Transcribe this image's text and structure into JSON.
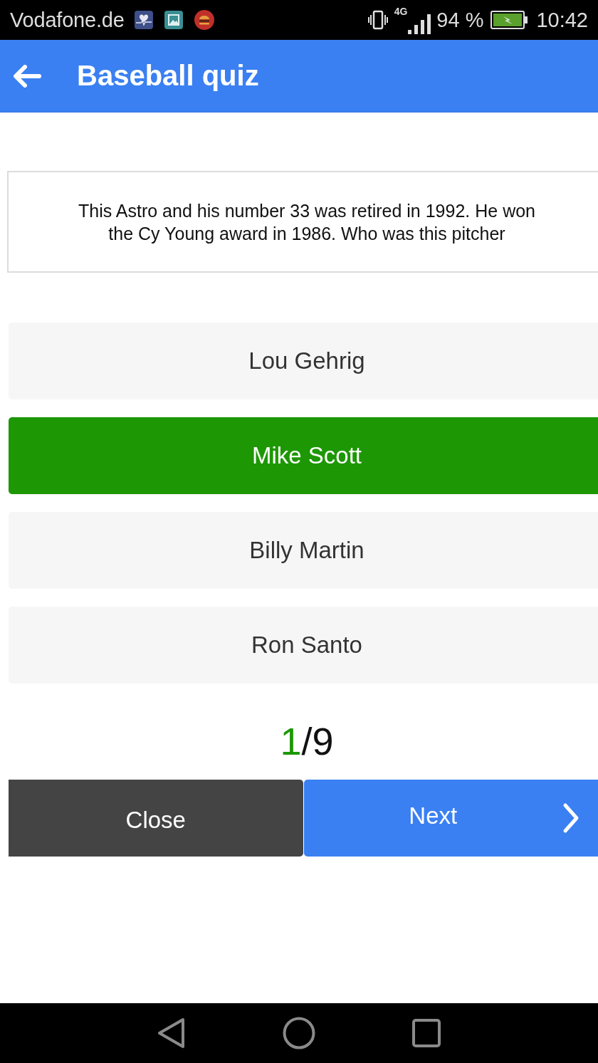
{
  "status_bar": {
    "carrier": "Vodafone.de",
    "network": "4G",
    "battery": "94 %",
    "time": "10:42"
  },
  "app_bar": {
    "title": "Baseball quiz"
  },
  "question": "This Astro and his number 33 was retired in 1992. He won the Cy Young award in 1986. Who was this pitcher",
  "answers": [
    {
      "label": "Lou Gehrig",
      "selected": false
    },
    {
      "label": "Mike Scott",
      "selected": true
    },
    {
      "label": "Billy Martin",
      "selected": false
    },
    {
      "label": "Ron Santo",
      "selected": false
    }
  ],
  "counter": {
    "current": "1",
    "rest": "/9"
  },
  "buttons": [
    {
      "kind": "close",
      "label": "Close"
    },
    {
      "kind": "next",
      "label": "Next"
    }
  ]
}
